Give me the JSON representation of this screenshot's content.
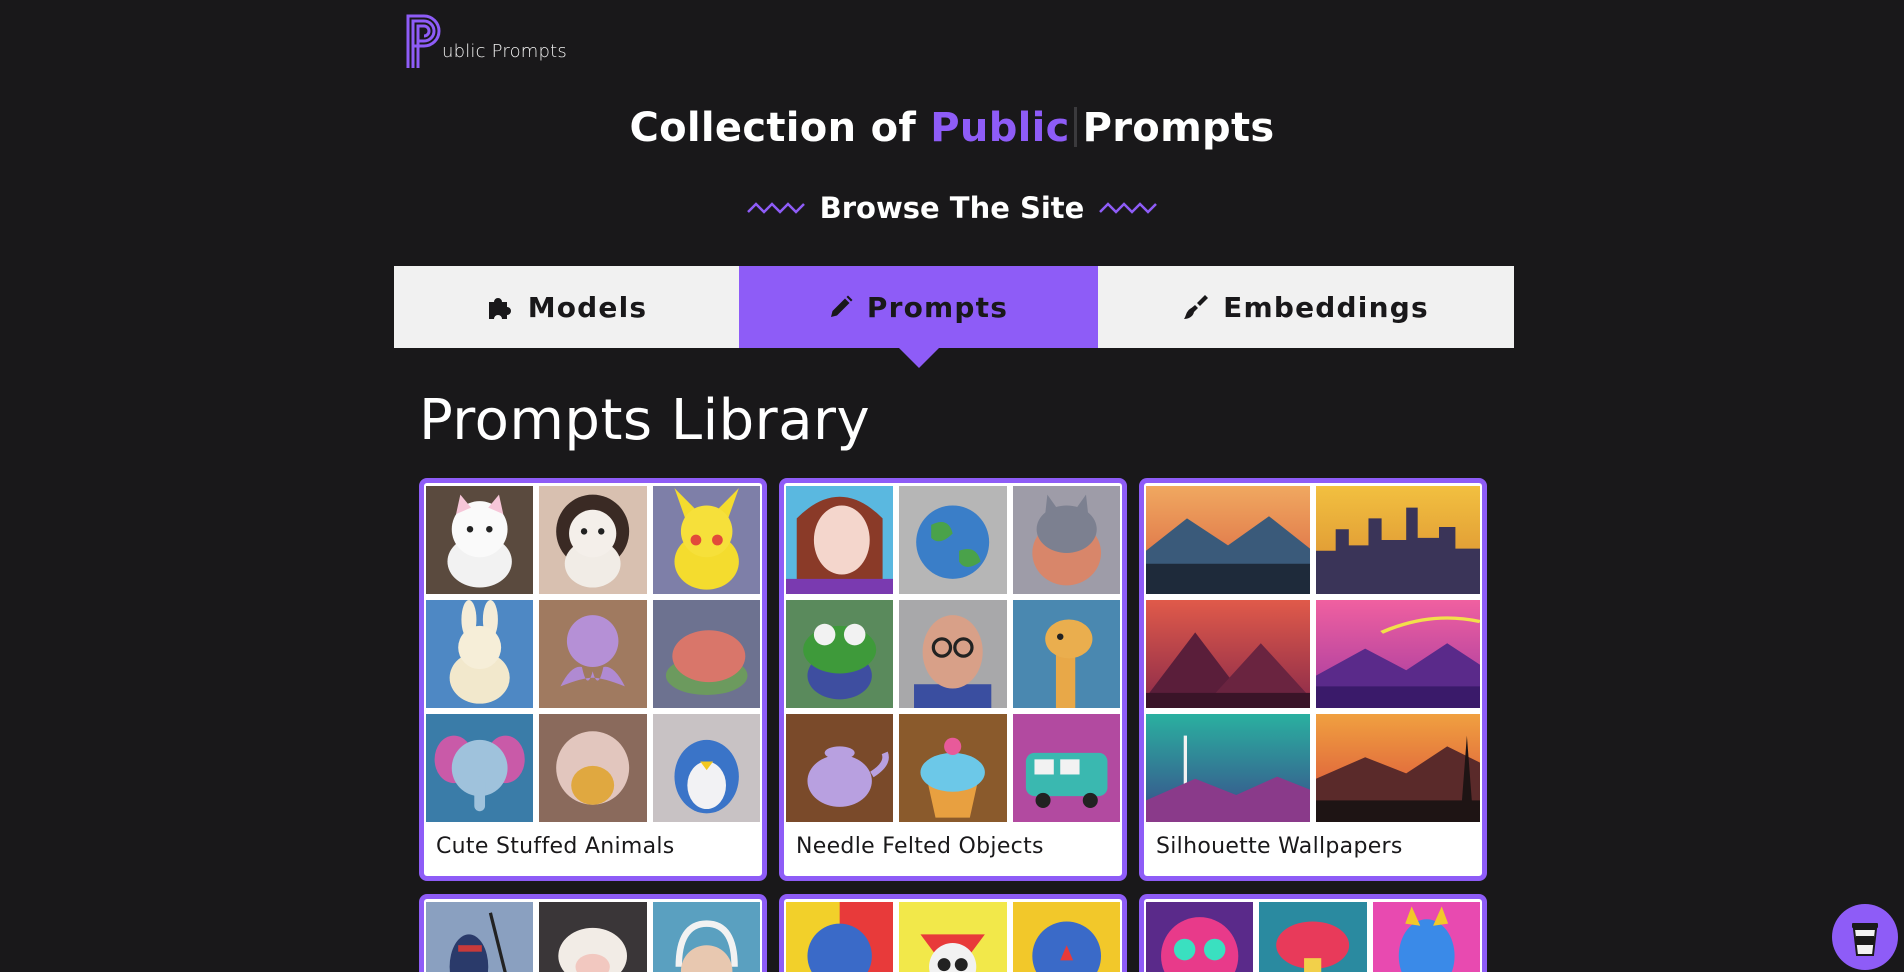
{
  "logo": {
    "text": "ublic Prompts"
  },
  "hero": {
    "before": "Collection of",
    "accent": "Public",
    "after": "Prompts"
  },
  "browse": {
    "title": "Browse The Site"
  },
  "tabs": [
    {
      "label": "Models",
      "icon": "puzzle-icon"
    },
    {
      "label": "Prompts",
      "icon": "pencil-icon",
      "active": true
    },
    {
      "label": "Embeddings",
      "icon": "brush-icon"
    }
  ],
  "library": {
    "title": "Prompts Library"
  },
  "cards": [
    {
      "title": "Cute Stuffed Animals"
    },
    {
      "title": "Needle Felted Objects"
    },
    {
      "title": "Silhouette Wallpapers"
    }
  ],
  "colors": {
    "accent": "#8e5cf7",
    "background": "#19181a",
    "tab": "#f1f1f1"
  }
}
